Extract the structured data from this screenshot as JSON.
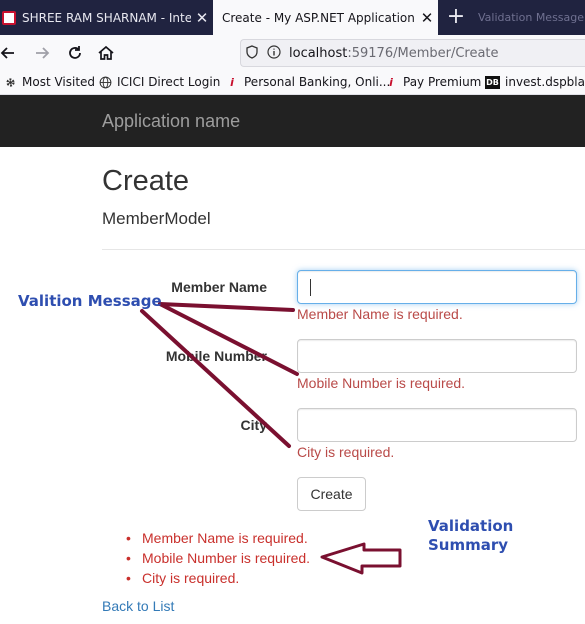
{
  "browser": {
    "tabs": [
      {
        "title": "SHREE RAM SHARNAM - Intern",
        "active": false
      },
      {
        "title": "Create - My ASP.NET Application",
        "active": true
      }
    ],
    "new_tab": "+",
    "close_glyph": "✕",
    "ghost_tab": "Validation Message and",
    "url": {
      "host": "localhost",
      "rest": ":59176/Member/Create"
    },
    "bookmarks": [
      {
        "label": "Most Visited",
        "icon": "gear-icon"
      },
      {
        "label": "ICICI Direct Login",
        "icon": "globe-icon"
      },
      {
        "label": "Personal Banking, Onli...",
        "icon": "icici-logo-icon"
      },
      {
        "label": "Pay Premium",
        "icon": "icici-logo-icon"
      },
      {
        "label": "invest.dspblack",
        "icon": "db-logo-icon"
      }
    ]
  },
  "app": {
    "brand": "Application name"
  },
  "page": {
    "title": "Create",
    "subtitle": "MemberModel",
    "fields": [
      {
        "label": "Member Name",
        "value": "",
        "error": "Member Name is required."
      },
      {
        "label": "Mobile Number",
        "value": "",
        "error": "Mobile Number is required."
      },
      {
        "label": "City",
        "value": "",
        "error": "City is required."
      }
    ],
    "submit_label": "Create",
    "summary": [
      "Member Name is required.",
      "Mobile Number is required.",
      "City is required."
    ],
    "back_link": "Back to List"
  },
  "annotations": {
    "message": "Valition Message",
    "summary_line1": "Validation",
    "summary_line2": "Summary",
    "color": "#2e4eb0",
    "arrow_color": "#7a1030"
  },
  "colors": {
    "error": "#b94a48",
    "summary_error": "#c9302c",
    "link": "#337ab7",
    "app_navbar": "#222222"
  }
}
